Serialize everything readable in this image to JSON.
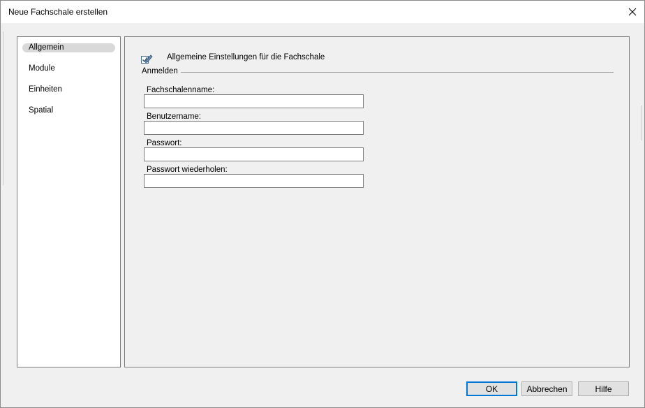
{
  "window": {
    "title": "Neue Fachschale erstellen",
    "close_icon": "close-icon"
  },
  "sidebar": {
    "items": [
      {
        "label": "Allgemein",
        "selected": true
      },
      {
        "label": "Module",
        "selected": false
      },
      {
        "label": "Einheiten",
        "selected": false
      },
      {
        "label": "Spatial",
        "selected": false
      }
    ]
  },
  "content": {
    "header_icon": "edit-checkbox-icon",
    "header_text": "Allgemeine Einstellungen für die Fachschale",
    "group_label": "Anmelden",
    "fields": [
      {
        "label": "Fachschalenname:",
        "value": ""
      },
      {
        "label": "Benutzername:",
        "value": ""
      },
      {
        "label": "Passwort:",
        "value": ""
      },
      {
        "label": "Passwort wiederholen:",
        "value": ""
      }
    ]
  },
  "buttons": {
    "ok": "OK",
    "cancel": "Abbrechen",
    "help": "Hilfe"
  },
  "colors": {
    "accent": "#0078d7",
    "selection": "#d9d9d9"
  }
}
